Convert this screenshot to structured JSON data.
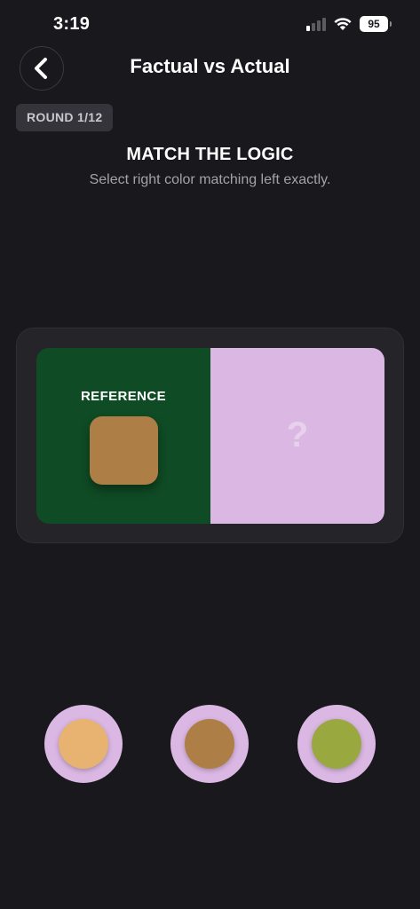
{
  "status_bar": {
    "time": "3:19",
    "battery": "95",
    "signal_icon": "cellular-signal-icon",
    "wifi_icon": "wifi-icon"
  },
  "header": {
    "title": "Factual vs Actual",
    "back_icon": "chevron-left-icon"
  },
  "round": {
    "label": "ROUND 1/12"
  },
  "instruction": {
    "title": "MATCH THE LOGIC",
    "subtitle": "Select right color matching left exactly."
  },
  "comparison": {
    "reference_label": "REFERENCE",
    "reference_bg": "#0f4b24",
    "reference_swatch": "#ad7e45",
    "target_bg": "#dbb8e4",
    "target_placeholder": "?"
  },
  "options": [
    {
      "ring": "#dbb8e4",
      "color": "#e8b270"
    },
    {
      "ring": "#dbb8e4",
      "color": "#ad7e45"
    },
    {
      "ring": "#dbb8e4",
      "color": "#9aa840"
    }
  ]
}
